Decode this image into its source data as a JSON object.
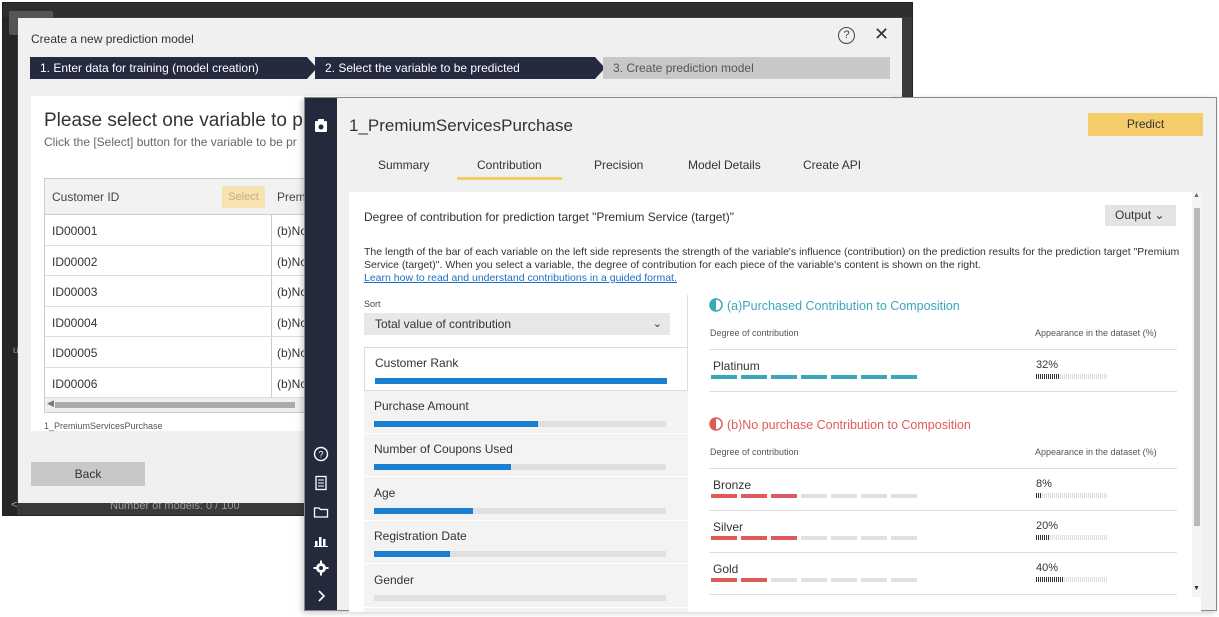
{
  "back_window": {
    "footer_models": "Number of models: 0 / 100",
    "dialog_title": "Create a new prediction model",
    "help_icon": "?",
    "close_icon": "✕",
    "steps": [
      "1. Enter data for training (model creation)",
      "2. Select the variable to be predicted",
      "3. Create prediction model"
    ],
    "heading": "Please select one variable to pre",
    "subheading": "Click the [Select] button for the variable to be pr",
    "table": {
      "col1_header": "Customer ID",
      "select_label": "Select",
      "col2_header": "Prem",
      "rows": [
        {
          "id": "ID00001",
          "val": "(b)No"
        },
        {
          "id": "ID00002",
          "val": "(b)No"
        },
        {
          "id": "ID00003",
          "val": "(b)No"
        },
        {
          "id": "ID00004",
          "val": "(b)No"
        },
        {
          "id": "ID00005",
          "val": "(b)No"
        },
        {
          "id": "ID00006",
          "val": "(b)No"
        }
      ]
    },
    "caption": "1_PremiumServicesPurchase",
    "back_button": "Back"
  },
  "front_window": {
    "model_title": "1_PremiumServicesPurchase",
    "predict_button": "Predict",
    "tabs": [
      "Summary",
      "Contribution",
      "Precision",
      "Model Details",
      "Create API"
    ],
    "active_tab": "Contribution",
    "content_title": "Degree of contribution for prediction target \"Premium Service (target)\"",
    "output_button": "Output",
    "description": "The length of the bar of each variable on the left side represents the strength of the variable's influence (contribution) on the prediction results for the prediction target \"Premium Service (target)\". When you select a variable, the degree of contribution for each piece of the variable's content is shown on the right.",
    "learn_link": "Learn how to read and understand contributions in a guided format.",
    "sort_label": "Sort",
    "sort_value": "Total value of contribution",
    "variables": [
      {
        "label": "Customer Rank",
        "value": 1.0,
        "selected": true
      },
      {
        "label": "Purchase Amount",
        "value": 0.56
      },
      {
        "label": "Number of Coupons Used",
        "value": 0.47
      },
      {
        "label": "Age",
        "value": 0.34
      },
      {
        "label": "Registration Date",
        "value": 0.26
      },
      {
        "label": "Gender",
        "value": 0.0
      }
    ],
    "purchased_section": {
      "title": "(a)Purchased Contribution to Composition",
      "color": "#3aa8b8",
      "col1": "Degree of contribution",
      "col2": "Appearance in the dataset (%)",
      "rows": [
        {
          "name": "Platinum",
          "segments_on": 7,
          "pct_label": "32%",
          "pct": 0.32
        }
      ]
    },
    "nopurchase_section": {
      "title": "(b)No purchase Contribution to Composition",
      "color": "#e05a5a",
      "col1": "Degree of contribution",
      "col2": "Appearance in the dataset (%)",
      "rows": [
        {
          "name": "Bronze",
          "segments_on": 3,
          "pct_label": "8%",
          "pct": 0.08
        },
        {
          "name": "Silver",
          "segments_on": 3,
          "pct_label": "20%",
          "pct": 0.2
        },
        {
          "name": "Gold",
          "segments_on": 2,
          "pct_label": "40%",
          "pct": 0.4
        }
      ]
    }
  }
}
